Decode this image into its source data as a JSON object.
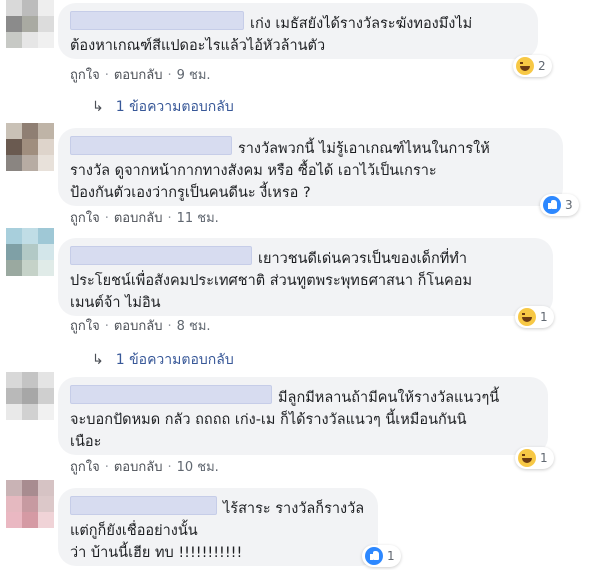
{
  "actions": {
    "like": "ถูกใจ",
    "reply": "ตอบกลับ",
    "sep": "·"
  },
  "comments": [
    {
      "lines": [
        "เก่ง เมธัสยังได้รางวัลระฆังทองมึงไม่",
        "ต้องหาเกณฑ์สีแปดอะไรแล้วไอ้หัวล้านตัว"
      ],
      "time": "9 ชม.",
      "reaction": {
        "type": "haha",
        "count": "2"
      },
      "replies": "1 ข้อความตอบกลับ",
      "avatar_colors": [
        "#d9d9d9",
        "#bcbcbc",
        "#eeeeee",
        "#8b8b8b",
        "#a9aaa2",
        "#dcdcdc",
        "#c7c9c5",
        "#e6e6e6",
        "#f0f0f0"
      ]
    },
    {
      "lines": [
        "รางวัลพวกนี้ ไม่รู้เอาเกณฑ์ไหนในการให้",
        "รางวัล ดูจากหน้ากากทางสังคม หรือ ซื้อได้ เอาไว้เป็นเกราะ",
        "ป้องกันตัวเองว่ากรูเป็นคนดีนะ งี้เหรอ ?"
      ],
      "time": "11 ชม.",
      "reaction": {
        "type": "like",
        "count": "3"
      },
      "replies": "",
      "avatar_colors": [
        "#c9c1b6",
        "#8f7f73",
        "#bfb4a7",
        "#6a5a50",
        "#a08e7e",
        "#ded4cb",
        "#8a8581",
        "#b7aca3",
        "#e8e1da"
      ]
    },
    {
      "lines": [
        "เยาวชนดีเด่นควรเป็นของเด็กที่ทำ",
        "ประโยชน์เพื่อสังคมประเทศชาติ ส่วนทูตพระพุทธศาสนา ก็โนคอม",
        "เมนต์จ้า ไม่อิน"
      ],
      "time": "8 ชม.",
      "reaction": {
        "type": "haha",
        "count": "1"
      },
      "replies": "1 ข้อความตอบกลับ",
      "avatar_colors": [
        "#a8cfdc",
        "#c0dde6",
        "#9fc8d6",
        "#7fa0a6",
        "#b2c9c6",
        "#d3e6ea",
        "#9aa9a0",
        "#c5d2c8",
        "#e0ebe8"
      ]
    },
    {
      "lines": [
        "มีลูกมีหลานถ้ามีคนให้รางวัลแนวๆนี้",
        "จะบอกปัดหมด กลัว ถถถถ เก่ง-เม ก็ได้รางวัลแนวๆ นี้เหมือนกันนิ",
        "เนือะ"
      ],
      "time": "10 ชม.",
      "reaction": {
        "type": "haha",
        "count": "1"
      },
      "replies": "",
      "avatar_colors": [
        "#d8d8d8",
        "#c4c4c4",
        "#e4e4e4",
        "#b9b9b9",
        "#a7a7a7",
        "#cfcfcf",
        "#e9e9e9",
        "#d1d1d1",
        "#f1f1f1"
      ]
    },
    {
      "lines": [
        "ไร้สาระ รางวัลก็รางวัล",
        "แต่กูก็ยังเชื่ออย่างนั้น",
        "ว่า บ้านนี้เฮีย ทบ !!!!!!!!!!!"
      ],
      "time": "",
      "reaction": {
        "type": "like",
        "count": "1"
      },
      "replies": "",
      "avatar_colors": [
        "#c9b3b5",
        "#a88c90",
        "#d6c3c4",
        "#e5b9c0",
        "#c79aa1",
        "#dcc8c9",
        "#eab8c2",
        "#d59aa4",
        "#f0d3d7"
      ]
    }
  ]
}
